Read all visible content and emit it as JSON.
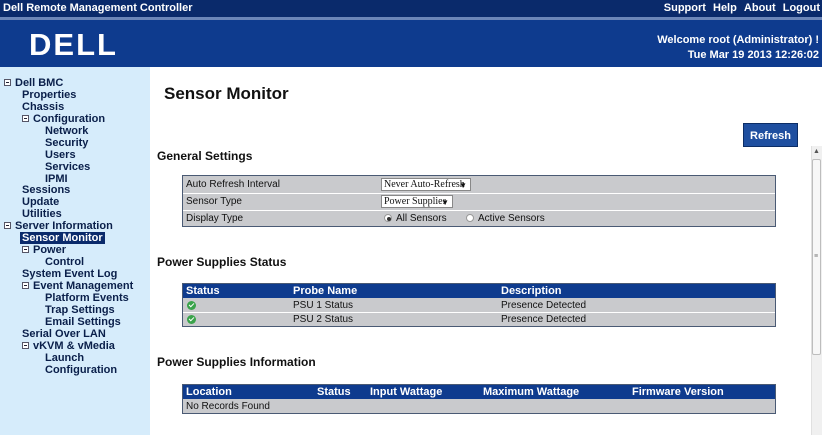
{
  "top_bar": {
    "app_title": "Dell Remote Management Controller",
    "links": [
      "Support",
      "Help",
      "About",
      "Logout"
    ]
  },
  "header": {
    "logo_text": "DELL",
    "welcome": "Welcome root (Administrator) !",
    "datetime": "Tue Mar 19 2013 12:26:02"
  },
  "sidebar": {
    "items": [
      {
        "label": "Dell BMC"
      },
      {
        "label": "Properties"
      },
      {
        "label": "Chassis"
      },
      {
        "label": "Configuration"
      },
      {
        "label": "Network"
      },
      {
        "label": "Security"
      },
      {
        "label": "Users"
      },
      {
        "label": "Services"
      },
      {
        "label": "IPMI"
      },
      {
        "label": "Sessions"
      },
      {
        "label": "Update"
      },
      {
        "label": "Utilities"
      },
      {
        "label": "Server Information"
      },
      {
        "label": "Sensor Monitor"
      },
      {
        "label": "Power"
      },
      {
        "label": "Control"
      },
      {
        "label": "System Event Log"
      },
      {
        "label": "Event Management"
      },
      {
        "label": "Platform Events"
      },
      {
        "label": "Trap Settings"
      },
      {
        "label": "Email Settings"
      },
      {
        "label": "Serial Over LAN"
      },
      {
        "label": "vKVM & vMedia"
      },
      {
        "label": "Launch"
      },
      {
        "label": "Configuration"
      }
    ]
  },
  "main": {
    "title": "Sensor Monitor",
    "refresh_label": "Refresh",
    "general_settings": {
      "heading": "General Settings",
      "auto_refresh_label": "Auto Refresh Interval",
      "auto_refresh_value": "Never Auto-Refresh",
      "sensor_type_label": "Sensor Type",
      "sensor_type_value": "Power Supplies",
      "display_type_label": "Display Type",
      "display_options": [
        "All Sensors",
        "Active Sensors"
      ],
      "display_selected": "All Sensors"
    },
    "status_table": {
      "heading": "Power Supplies Status",
      "columns": [
        "Status",
        "Probe Name",
        "Description"
      ],
      "rows": [
        {
          "status": "ok",
          "probe": "PSU 1 Status",
          "description": "Presence Detected"
        },
        {
          "status": "ok",
          "probe": "PSU 2 Status",
          "description": "Presence Detected"
        }
      ]
    },
    "info_table": {
      "heading": "Power Supplies Information",
      "columns": [
        "Location",
        "Status",
        "Input Wattage",
        "Maximum Wattage",
        "Firmware Version"
      ],
      "empty_text": "No Records Found"
    }
  },
  "colors": {
    "top_bar": "#0a2a6b",
    "header": "#0e3b8e",
    "sidebar": "#d6ecfb",
    "table_header": "#0e3b8e",
    "table_body": "#c9cacd",
    "status_ok": "#3aa34b"
  },
  "icons": {
    "status_ok": "green-check-circle-icon",
    "expand": "collapse-minus-icon"
  }
}
